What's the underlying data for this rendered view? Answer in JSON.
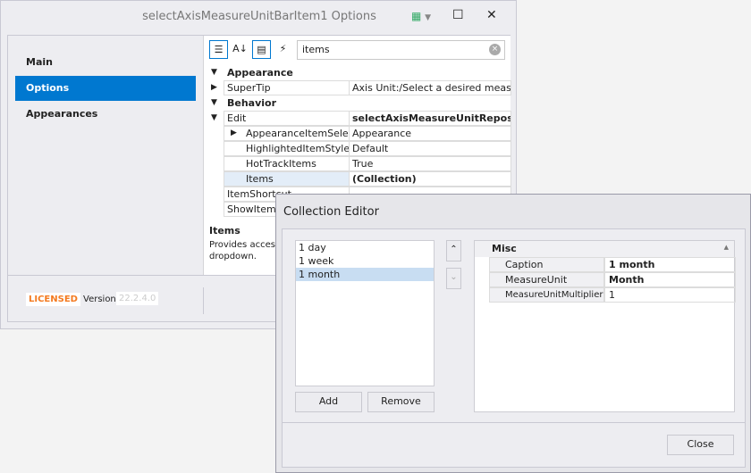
{
  "main_window": {
    "title": "selectAxisMeasureUnitBarItem1 Options",
    "nav": [
      {
        "label": "Main"
      },
      {
        "label": "Options"
      },
      {
        "label": "Appearances"
      }
    ],
    "search": {
      "value": "items"
    },
    "grid": {
      "categories": [
        "Appearance",
        "Behavior"
      ],
      "rows": [
        {
          "name": "SuperTip",
          "value": "Axis Unit:/Select a desired measurem"
        },
        {
          "name": "Edit",
          "value": "selectAxisMeasureUnitReposito"
        },
        {
          "name": "AppearanceItemSelected",
          "value": "Appearance"
        },
        {
          "name": "HighlightedItemStyle",
          "value": "Default"
        },
        {
          "name": "HotTrackItems",
          "value": "True"
        },
        {
          "name": "Items",
          "value": "(Collection)"
        },
        {
          "name": "ItemShortcut",
          "value": ""
        },
        {
          "name": "ShowItemShortcut",
          "value": ""
        }
      ]
    },
    "description": {
      "title": "Items",
      "text": "Provides access",
      "text2": "dropdown."
    },
    "footer": {
      "licensed": "LICENSED",
      "version_label": "Version",
      "version": "22.2.4.0"
    }
  },
  "collection_editor": {
    "title": "Collection Editor",
    "items": [
      "1 day",
      "1 week",
      "1 month"
    ],
    "selected": "1 month",
    "add": "Add",
    "remove": "Remove",
    "close": "Close",
    "properties": {
      "category": "Misc",
      "rows": [
        {
          "name": "Caption",
          "value": "1 month"
        },
        {
          "name": "MeasureUnit",
          "value": "Month"
        },
        {
          "name": "MeasureUnitMultiplier",
          "value": "1"
        }
      ]
    }
  },
  "colors": {
    "accent": "#0078d0",
    "licensed": "#f47a20"
  }
}
